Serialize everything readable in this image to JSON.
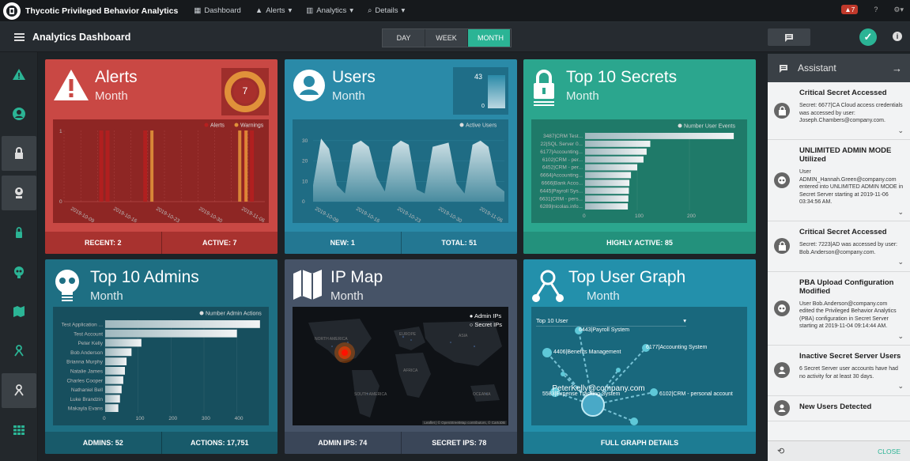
{
  "app": {
    "title": "Thycotic Privileged Behavior Analytics"
  },
  "nav": [
    {
      "label": "Dashboard",
      "icon": "grid-icon"
    },
    {
      "label": "Alerts",
      "icon": "warning-icon"
    },
    {
      "label": "Analytics",
      "icon": "bar-chart-icon"
    },
    {
      "label": "Details",
      "icon": "search-icon"
    }
  ],
  "topright": {
    "alert_count": "7"
  },
  "dashboard": {
    "title": "Analytics Dashboard",
    "ranges": [
      "DAY",
      "WEEK",
      "MONTH"
    ],
    "active_range": "MONTH"
  },
  "colors": {
    "alerts": "#c94844",
    "users": "#2a8aa8",
    "secrets": "#2ba68e",
    "admins": "#1e6f83",
    "ipmap": "#465367",
    "graph": "#2390ab",
    "accent": "#2bb495"
  },
  "cards": {
    "alerts": {
      "title": "Alerts",
      "sub": "Month",
      "gauge": "7",
      "legend": [
        "Alerts",
        "Warnings"
      ],
      "xticks": [
        "2019-10-09",
        "2019-10-16",
        "2019-10-23",
        "2019-10-30",
        "2019-11-06"
      ],
      "yticks": [
        "1",
        "0"
      ],
      "foot": [
        "RECENT: 2",
        "ACTIVE: 7"
      ]
    },
    "users": {
      "title": "Users",
      "sub": "Month",
      "mini_max": "43",
      "mini_min": "0",
      "legend": "Active Users",
      "xticks": [
        "2019-10-09",
        "2019-10-16",
        "2019-10-23",
        "2019-10-30",
        "2019-11-06"
      ],
      "yticks": [
        "30",
        "20",
        "10",
        "0"
      ],
      "foot": [
        "NEW: 1",
        "TOTAL: 51"
      ]
    },
    "secrets": {
      "title": "Top 10 Secrets",
      "sub": "Month",
      "legend": "Number User Events",
      "xticks": [
        "0",
        "100",
        "200"
      ],
      "foot": [
        "HIGHLY ACTIVE: 85"
      ]
    },
    "admins": {
      "title": "Top 10 Admins",
      "sub": "Month",
      "legend": "Number Admin Actions",
      "xticks": [
        "0",
        "100",
        "200",
        "300",
        "400"
      ],
      "foot": [
        "ADMINS: 52",
        "ACTIONS: 17,751"
      ]
    },
    "ipmap": {
      "title": "IP Map",
      "sub": "Month",
      "legend": [
        "Admin IPs",
        "Secret IPs"
      ],
      "regions": [
        "NORTH AMERICA",
        "SOUTH AMERICA",
        "AFRICA",
        "ASIA",
        "EUROPE",
        "OCEANIA"
      ],
      "attribution": "Leaflet | © OpenStreetMap contributors, © CartoDB",
      "foot": [
        "ADMIN IPS: 74",
        "SECRET IPS: 78"
      ]
    },
    "graph": {
      "title": "Top User Graph",
      "sub": "Month",
      "select": "Top 10 User",
      "center": "PeterKelly@company.com",
      "nodes": [
        "6443|Payroll System",
        "4406|Benefits Management",
        "6177|Accounting System",
        "5583|Expense Tracking System",
        "6102|CRM - personal account"
      ],
      "foot": [
        "FULL GRAPH DETAILS"
      ]
    }
  },
  "chart_data": [
    {
      "type": "bar",
      "title": "Alerts",
      "series": [
        {
          "name": "Alerts",
          "x": [
            "2019-10-12",
            "2019-10-13",
            "2019-10-19",
            "2019-11-04",
            "2019-11-05"
          ],
          "values": [
            1,
            1,
            1,
            1,
            1
          ]
        },
        {
          "name": "Warnings",
          "x": [
            "2019-10-20",
            "2019-11-03",
            "2019-11-04"
          ],
          "values": [
            1,
            1,
            1
          ]
        }
      ],
      "ylim": [
        0,
        1
      ]
    },
    {
      "type": "area",
      "title": "Users",
      "series": [
        {
          "name": "Active Users",
          "values": [
            8,
            31,
            26,
            8,
            4,
            28,
            30,
            27,
            12,
            5,
            27,
            30,
            28,
            6,
            4,
            27,
            28,
            29,
            9,
            4,
            28,
            30,
            27,
            8,
            5
          ]
        }
      ],
      "ylim": [
        0,
        35
      ]
    },
    {
      "type": "bar",
      "title": "Top 10 Secrets",
      "categories": [
        "3487|CRM Test...",
        "22|SQL Server 0...",
        "6177|Accounting...",
        "6102|CRM - per...",
        "6452|CRM - per...",
        "6664|Accounting...",
        "6666|Bank Acco...",
        "6445|Payroll Sys...",
        "6631|CRM - pers...",
        "6289|nicolas.info..."
      ],
      "series": [
        {
          "name": "Number User Events",
          "values": [
            285,
            125,
            118,
            112,
            100,
            88,
            85,
            84,
            83,
            82
          ]
        }
      ],
      "xlim": [
        0,
        300
      ]
    },
    {
      "type": "bar",
      "title": "Top 10 Admins",
      "categories": [
        "Test Application ...",
        "Test Account",
        "Peter Kelly",
        "Bob Anderson",
        "Brianna Murphy",
        "Natalie James",
        "Charles Cooper",
        "Nathaniel Bell",
        "Luke Brandzin",
        "Makayla Evans"
      ],
      "series": [
        {
          "name": "Number Admin Actions",
          "values": [
            470,
            400,
            110,
            80,
            65,
            60,
            55,
            50,
            45,
            40
          ]
        }
      ],
      "xlim": [
        0,
        480
      ]
    }
  ],
  "assistant": {
    "title": "Assistant",
    "close": "CLOSE",
    "items": [
      {
        "title": "Critical Secret Accessed",
        "body": "Secret: 6677|CA Cloud access credentials was accessed by user: Joseph.Chambers@company.com.",
        "icon": "lock-icon"
      },
      {
        "title": "UNLIMITED ADMIN MODE Utilized",
        "body": "User ADMIN_Hannah.Green@company.com entered into UNLIMITED ADMIN MODE in Secret Server starting at 2019-11-06 03:34:56 AM.",
        "icon": "brain-icon"
      },
      {
        "title": "Critical Secret Accessed",
        "body": "Secret: 7223|AD was accessed by user: Bob.Anderson@company.com.",
        "icon": "lock-icon"
      },
      {
        "title": "PBA Upload Configuration Modified",
        "body": "User Bob.Anderson@company.com edited the Privileged Behavior Analytics (PBA) configuration in Secret Server starting at 2019-11-04 09:14:44 AM.",
        "icon": "brain-icon"
      },
      {
        "title": "Inactive Secret Server Users",
        "body": "6 Secret Server user accounts have had no activity for at least 30 days.",
        "icon": "user-icon"
      },
      {
        "title": "New Users Detected",
        "body": "",
        "icon": "user-icon"
      }
    ]
  }
}
